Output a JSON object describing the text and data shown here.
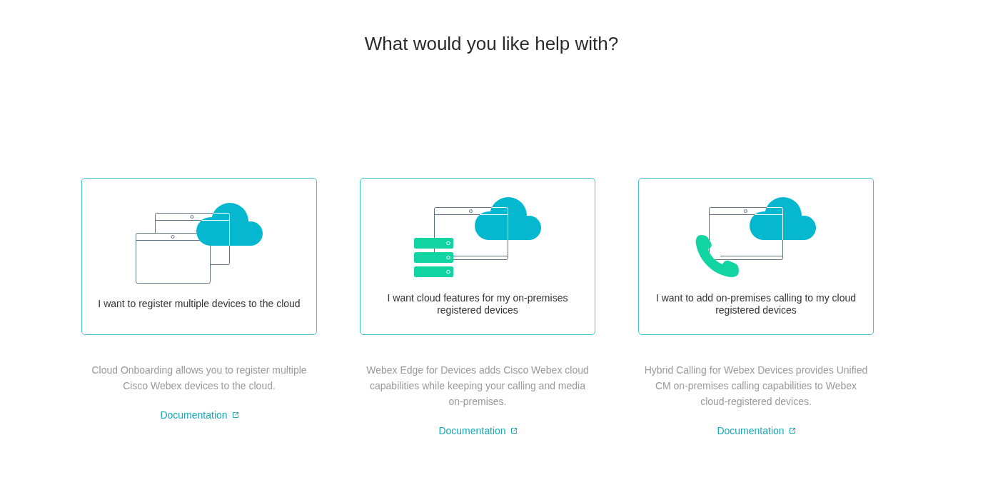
{
  "page": {
    "title": "What would you like help with?"
  },
  "options": [
    {
      "kind": "multi_device",
      "label": "I want to register multiple devices to the cloud",
      "description": "Cloud Onboarding allows you to register multiple\nCisco Webex devices to the cloud.",
      "link": "Documentation"
    },
    {
      "kind": "on_premises",
      "label": "I want cloud features for my on-premises\nregistered devices",
      "description": "Webex Edge for Devices adds Cisco Webex cloud\ncapabilities while keeping your calling and media\non-premises.",
      "link": "Documentation"
    },
    {
      "kind": "calling",
      "label": "I want to add on-premises calling to my cloud\nregistered devices",
      "description": "Hybrid Calling for Webex Devices provides Unified\nCM on-premises calling capabilities to Webex\ncloud-registered devices.",
      "link": "Documentation"
    }
  ]
}
